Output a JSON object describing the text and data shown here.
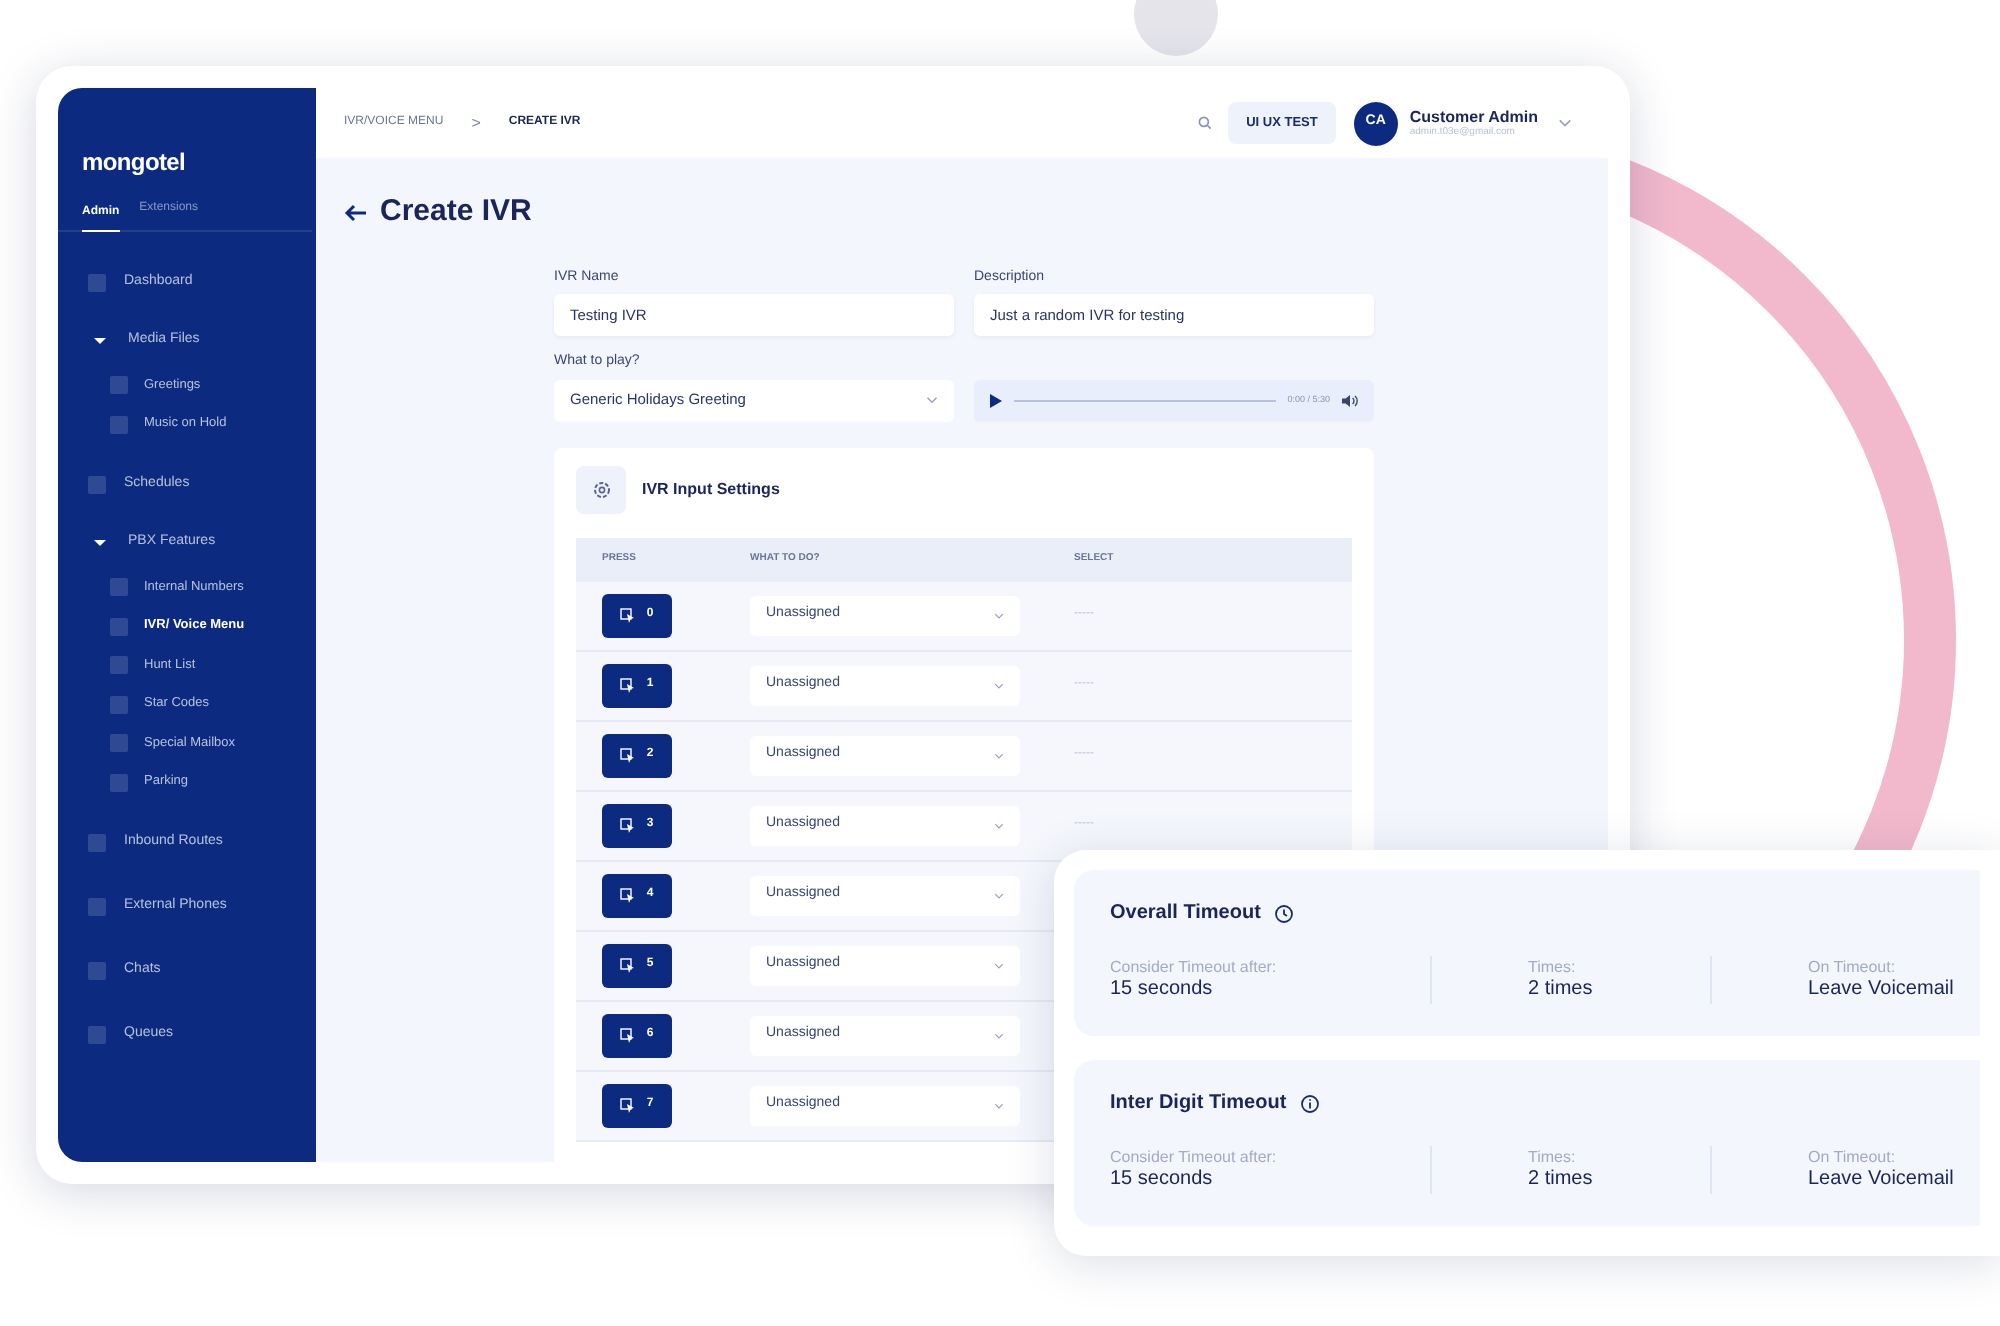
{
  "brand": "mongotel",
  "sidebar": {
    "tabs": [
      {
        "label": "Admin",
        "selected": true
      },
      {
        "label": "Extensions",
        "selected": false
      }
    ],
    "items": [
      {
        "kind": "link",
        "label": "Dashboard",
        "selected": false
      },
      {
        "kind": "group",
        "label": "Media Files",
        "expanded": true,
        "children": [
          {
            "label": "Greetings",
            "selected": false
          },
          {
            "label": "Music on Hold",
            "selected": false
          }
        ]
      },
      {
        "kind": "link",
        "label": "Schedules",
        "selected": false
      },
      {
        "kind": "group",
        "label": "PBX Features",
        "expanded": true,
        "children": [
          {
            "label": "Internal Numbers",
            "selected": false
          },
          {
            "label": "IVR/ Voice Menu",
            "selected": true
          },
          {
            "label": "Hunt List",
            "selected": false
          },
          {
            "label": "Star Codes",
            "selected": false
          },
          {
            "label": "Special Mailbox",
            "selected": false
          },
          {
            "label": "Parking",
            "selected": false
          }
        ]
      },
      {
        "kind": "link",
        "label": "Inbound Routes",
        "selected": false
      },
      {
        "kind": "link",
        "label": "External Phones",
        "selected": false
      },
      {
        "kind": "link",
        "label": "Chats",
        "selected": false
      },
      {
        "kind": "link",
        "label": "Queues",
        "selected": false
      }
    ]
  },
  "header": {
    "breadcrumb": [
      "IVR/VOICE MENU",
      "CREATE IVR"
    ],
    "separator": ">",
    "account_button": "UI UX TEST",
    "avatar": "CA",
    "user_name": "Customer Admin",
    "user_email": "admin.t03e@gmail.com"
  },
  "page_title": "Create IVR",
  "form": {
    "name_label": "IVR Name",
    "name_value": "Testing IVR",
    "description_label": "Description",
    "description_value": "Just a random IVR for testing",
    "play_label": "What to play?",
    "play_value": "Generic Holidays Greeting",
    "player_time": "0:00 / 5:30"
  },
  "settings": {
    "title": "IVR Input Settings",
    "columns": [
      "PRESS",
      "WHAT TO DO?",
      "SELECT"
    ],
    "rows": [
      {
        "press": "0",
        "action": "Unassigned",
        "select": "-----"
      },
      {
        "press": "1",
        "action": "Unassigned",
        "select": "-----"
      },
      {
        "press": "2",
        "action": "Unassigned",
        "select": "-----"
      },
      {
        "press": "3",
        "action": "Unassigned",
        "select": "-----"
      },
      {
        "press": "4",
        "action": "Unassigned"
      },
      {
        "press": "5",
        "action": "Unassigned"
      },
      {
        "press": "6",
        "action": "Unassigned"
      },
      {
        "press": "7",
        "action": "Unassigned"
      }
    ]
  },
  "timeouts": [
    {
      "title": "Overall Timeout",
      "fields": [
        {
          "label": "Consider Timeout after:",
          "value": "15 seconds"
        },
        {
          "label": "Times:",
          "value": "2 times"
        },
        {
          "label": "On Timeout:",
          "value": "Leave Voicemail"
        }
      ]
    },
    {
      "title": "Inter Digit Timeout",
      "fields": [
        {
          "label": "Consider Timeout after:",
          "value": "15 seconds"
        },
        {
          "label": "Times:",
          "value": "2 times"
        },
        {
          "label": "On Timeout:",
          "value": "Leave Voicemail"
        }
      ]
    }
  ]
}
